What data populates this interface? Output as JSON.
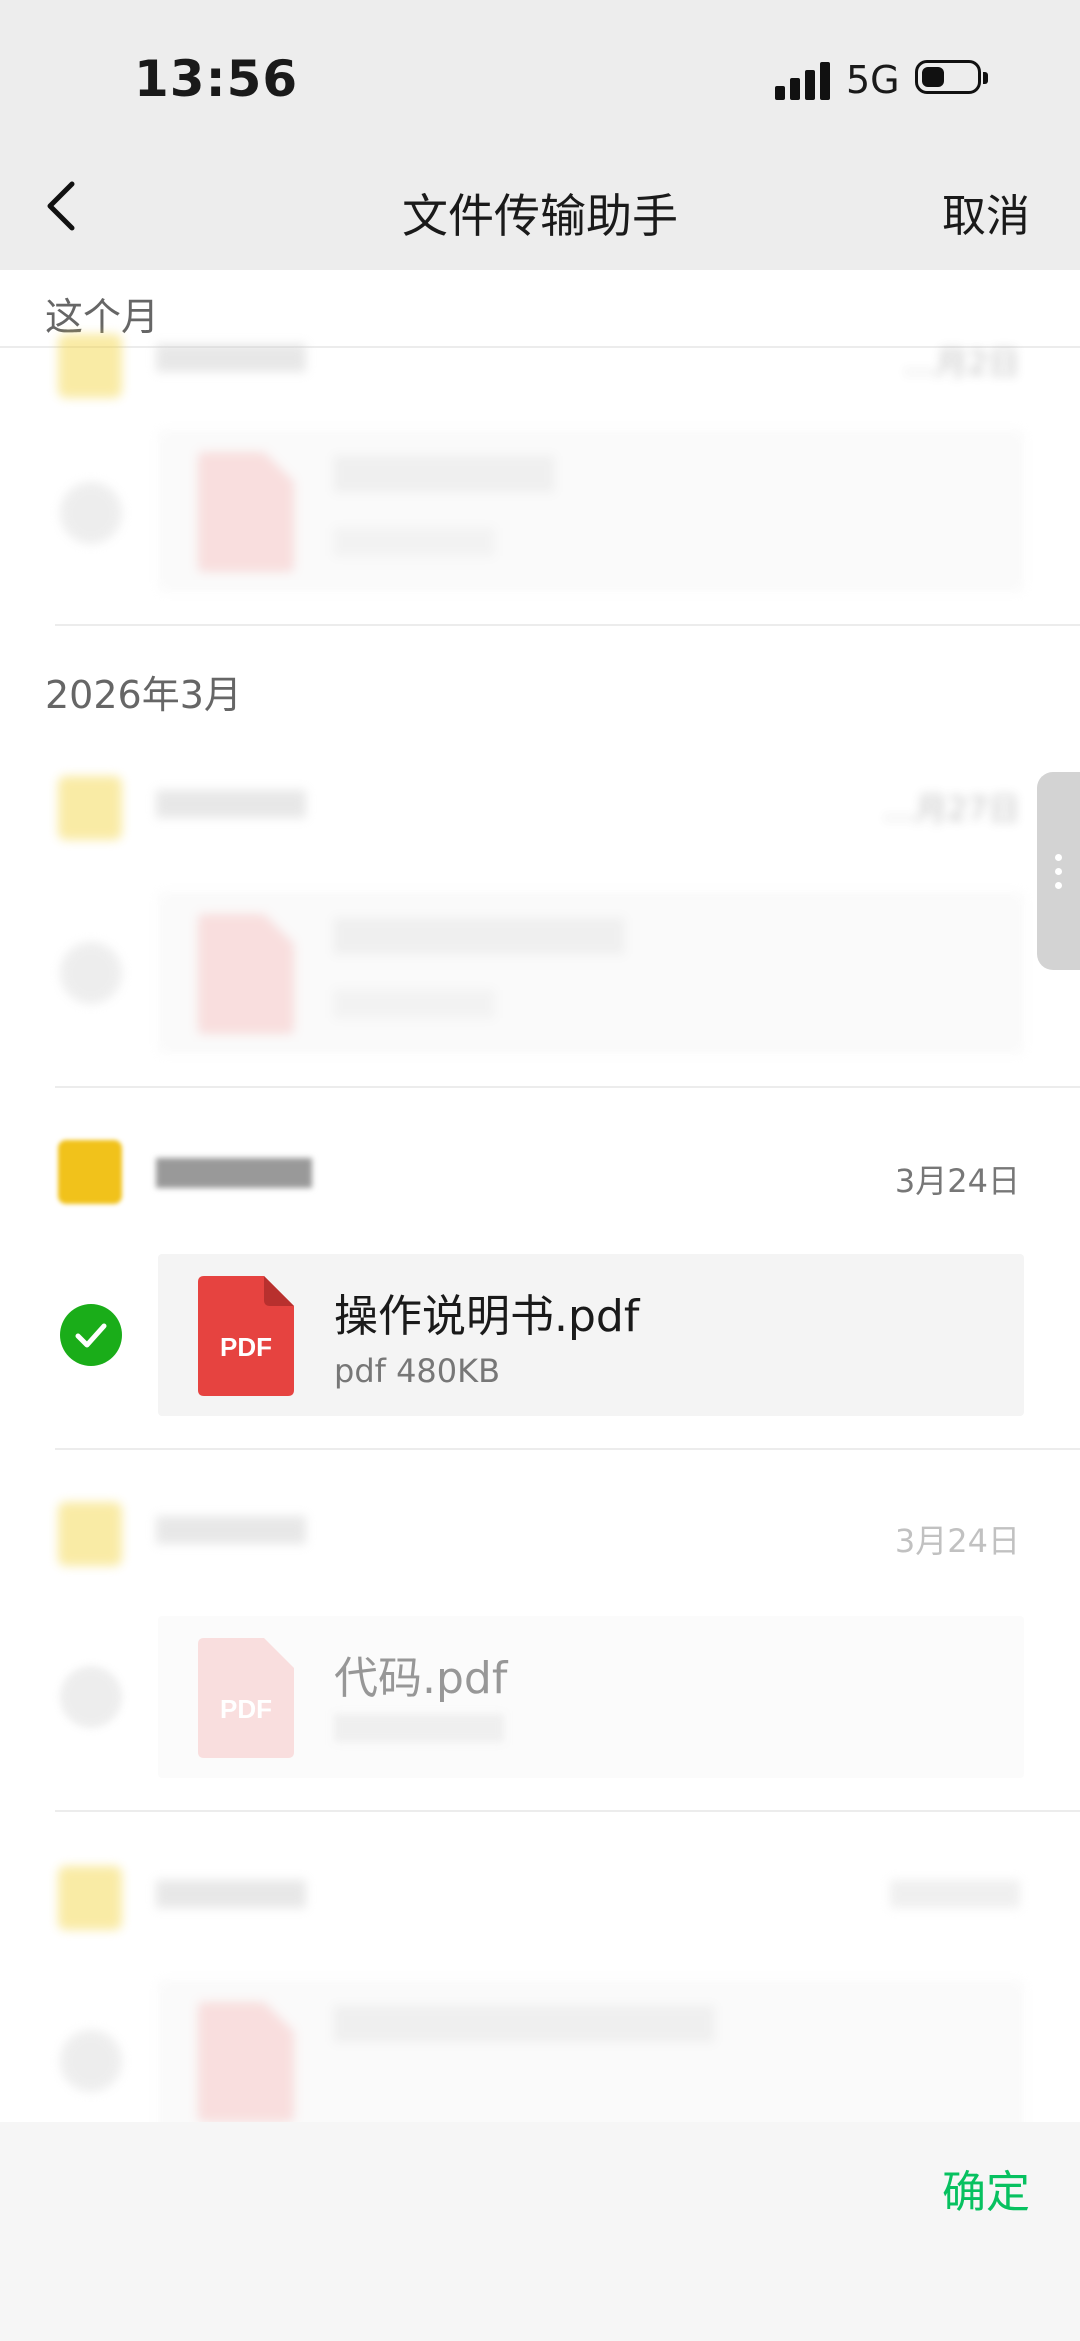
{
  "status_bar": {
    "time": "13:56",
    "network": "5G"
  },
  "nav": {
    "title": "文件传输助手",
    "cancel_label": "取消"
  },
  "sections": [
    {
      "month": "这个月"
    },
    {
      "month": "2026年3月"
    }
  ],
  "messages": [
    {
      "date": "…月2日",
      "file_name": "",
      "file_meta": ""
    },
    {
      "date": "…月27日",
      "file_name": "",
      "file_meta": ""
    },
    {
      "date": "3月24日",
      "file_name": "操作说明书.pdf",
      "file_meta": "pdf 480KB",
      "checked": true
    },
    {
      "date": "3月24日",
      "file_name": "代码.pdf",
      "file_meta": ""
    },
    {
      "date": "",
      "file_name": "",
      "file_meta": ""
    }
  ],
  "pdf_icon_label": "PDF",
  "footer": {
    "confirm_label": "确定"
  },
  "colors": {
    "accent_green": "#07c160",
    "check_green": "#1aad19",
    "pdf_red": "#e64340"
  }
}
